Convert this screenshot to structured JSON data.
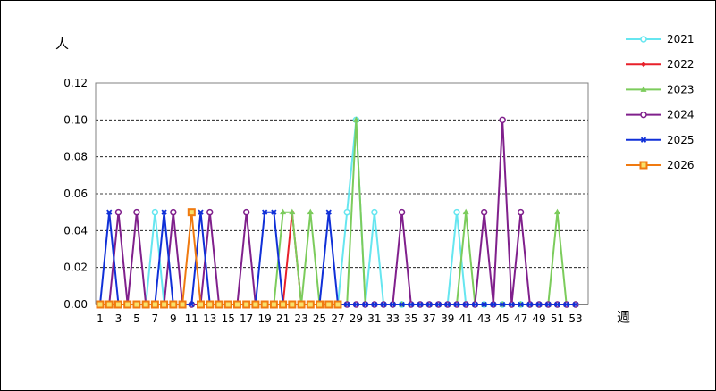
{
  "chart_data": {
    "type": "line",
    "ylabel": "人",
    "xlabel": "週",
    "ylim": [
      0,
      0.12
    ],
    "yticks": [
      "0.00",
      "0.02",
      "0.04",
      "0.06",
      "0.08",
      "0.10",
      "0.12"
    ],
    "xticks": [
      "1",
      "3",
      "5",
      "7",
      "9",
      "11",
      "13",
      "15",
      "17",
      "19",
      "21",
      "23",
      "25",
      "27",
      "29",
      "31",
      "33",
      "35",
      "37",
      "39",
      "41",
      "43",
      "45",
      "47",
      "49",
      "51",
      "53"
    ],
    "x_weeks_total": 53,
    "grid": "horizontal dashed",
    "legend_position": "right",
    "series": [
      {
        "name": "2021",
        "color": "#66e6f0",
        "marker": "circle-open",
        "values": [
          0,
          0,
          0,
          0,
          0,
          0,
          0.05,
          0,
          0,
          0,
          0,
          0,
          0,
          0,
          0,
          0,
          0,
          0,
          0,
          0,
          0,
          0,
          0,
          0,
          0,
          0,
          0,
          0.05,
          0.1,
          0,
          0.05,
          0,
          0,
          0,
          0,
          0,
          0,
          0,
          0,
          0.05,
          0,
          0,
          0,
          0,
          0,
          0,
          0,
          0,
          0,
          0,
          0,
          0,
          0
        ]
      },
      {
        "name": "2022",
        "color": "#e8202a",
        "marker": "diamond",
        "values": [
          0,
          0,
          0,
          0,
          0,
          0,
          0,
          0,
          0,
          0,
          0,
          0,
          0,
          0,
          0,
          0,
          0,
          0,
          0,
          0,
          0,
          0.05,
          0,
          0,
          0,
          0,
          0,
          0,
          0,
          0,
          0,
          0,
          0,
          0,
          0,
          0,
          0,
          0,
          0,
          0,
          0,
          0,
          0,
          0,
          0,
          0,
          0,
          0,
          0,
          0,
          0,
          0,
          0
        ]
      },
      {
        "name": "2023",
        "color": "#7ccc5c",
        "marker": "triangle",
        "values": [
          0,
          0,
          0,
          0,
          0,
          0,
          0,
          0,
          0,
          0,
          0,
          0,
          0,
          0,
          0,
          0,
          0,
          0,
          0,
          0,
          0.05,
          0.05,
          0,
          0.05,
          0,
          0,
          0,
          0,
          0.1,
          0,
          0,
          0,
          0,
          0,
          0,
          0,
          0,
          0,
          0,
          0,
          0.05,
          0,
          0,
          0,
          0,
          0,
          0,
          0,
          0,
          0,
          0.05,
          0,
          0
        ]
      },
      {
        "name": "2024",
        "color": "#80208c",
        "marker": "circle-open",
        "values": [
          0,
          0,
          0.05,
          0,
          0.05,
          0,
          0,
          0,
          0.05,
          0,
          0,
          0,
          0.05,
          0,
          0,
          0,
          0.05,
          0,
          0,
          0,
          0,
          0,
          0,
          0,
          0,
          0,
          0,
          0,
          0,
          0,
          0,
          0,
          0,
          0.05,
          0,
          0,
          0,
          0,
          0,
          0,
          0,
          0,
          0.05,
          0,
          0.1,
          0,
          0.05,
          0,
          0,
          0,
          0,
          0,
          0
        ]
      },
      {
        "name": "2025",
        "color": "#1030d8",
        "marker": "x",
        "values": [
          0,
          0.05,
          0,
          0,
          0,
          0,
          0,
          0.05,
          0,
          0,
          0,
          0.05,
          0,
          0,
          0,
          0,
          0,
          0,
          0.05,
          0.05,
          0,
          0,
          0,
          0,
          0,
          0.05,
          0,
          0,
          0,
          0,
          0,
          0,
          0,
          0,
          0,
          0,
          0,
          0,
          0,
          0,
          0,
          0,
          0,
          0,
          0,
          0,
          0,
          0,
          0,
          0,
          0,
          0,
          0
        ]
      },
      {
        "name": "2026",
        "color": "#f07a10",
        "marker": "square",
        "values": [
          0,
          0,
          0,
          0,
          0,
          0,
          0,
          0,
          0,
          0,
          0.05,
          0,
          0,
          0,
          0,
          0,
          0,
          0,
          0,
          0,
          0,
          0,
          0,
          0,
          0,
          0,
          0
        ]
      }
    ]
  }
}
